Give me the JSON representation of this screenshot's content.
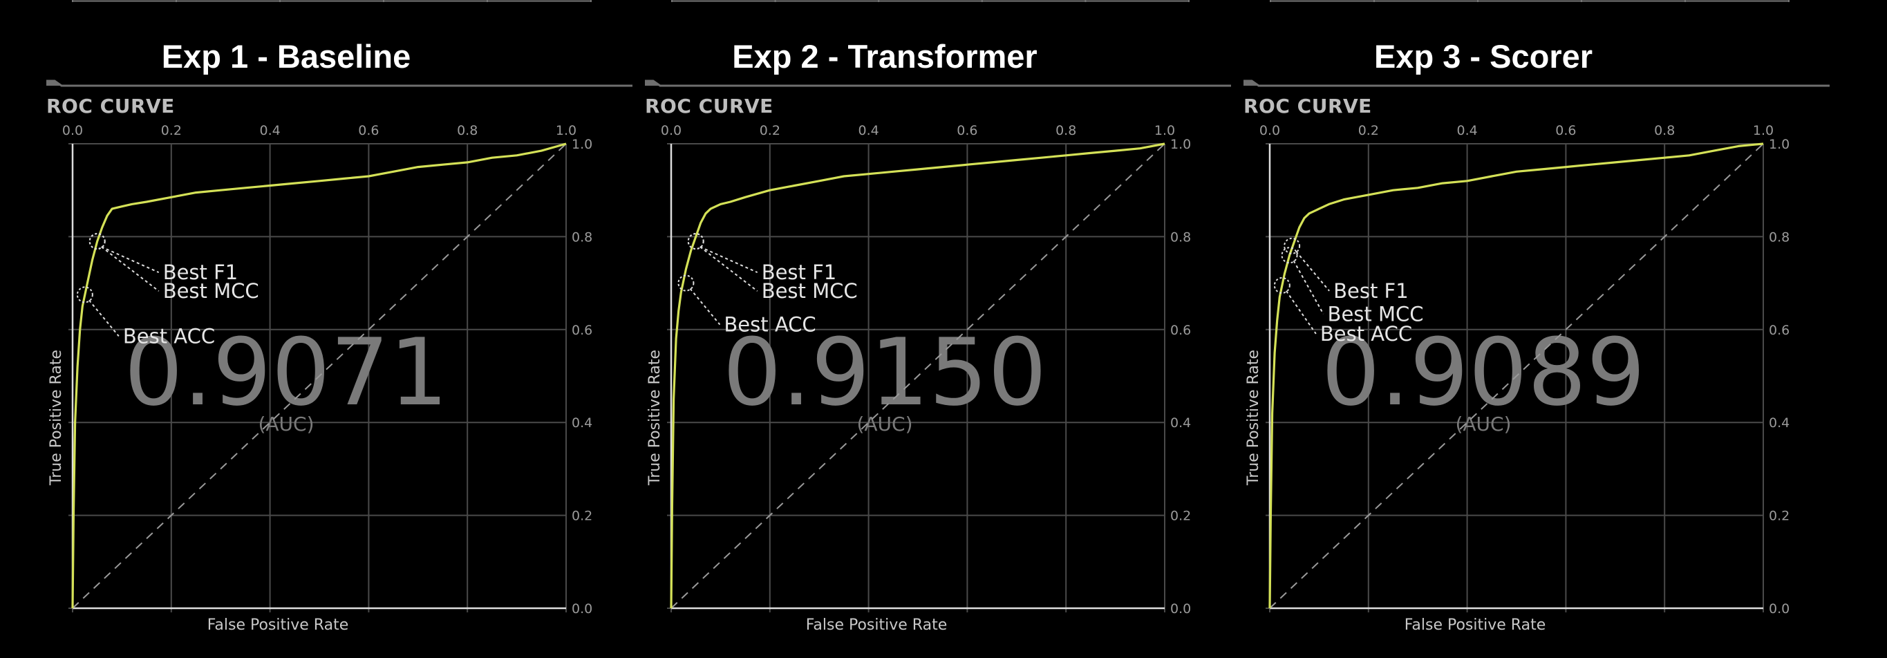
{
  "colors": {
    "background": "#000000",
    "curve": "#d4e157",
    "grid": "#4a4a4a",
    "axis": "#dddddd",
    "text": "#ffffff",
    "muted": "#7a7a7a"
  },
  "chart_data": [
    {
      "type": "line",
      "title": "Exp 1 - Baseline",
      "section_label": "ROC CURVE",
      "xlabel": "False Positive Rate",
      "ylabel": "True Positive Rate",
      "xlim": [
        0,
        1
      ],
      "ylim": [
        0,
        1
      ],
      "x_ticks": [
        "0.0",
        "0.2",
        "0.4",
        "0.6",
        "0.8",
        "1.0"
      ],
      "y_ticks": [
        "0.0",
        "0.2",
        "0.4",
        "0.6",
        "0.8",
        "1.0"
      ],
      "grid": true,
      "auc_value": "0.9071",
      "auc_label": "(AUC)",
      "series": [
        {
          "x": [
            0,
            0.002,
            0.005,
            0.01,
            0.015,
            0.02,
            0.03,
            0.04,
            0.05,
            0.06,
            0.07,
            0.08,
            0.1,
            0.12,
            0.15,
            0.2,
            0.25,
            0.3,
            0.35,
            0.4,
            0.45,
            0.5,
            0.55,
            0.6,
            0.65,
            0.7,
            0.75,
            0.8,
            0.85,
            0.9,
            0.95,
            1.0
          ],
          "y": [
            0,
            0.2,
            0.4,
            0.52,
            0.6,
            0.65,
            0.7,
            0.75,
            0.79,
            0.82,
            0.845,
            0.86,
            0.865,
            0.87,
            0.875,
            0.885,
            0.895,
            0.9,
            0.905,
            0.91,
            0.915,
            0.92,
            0.925,
            0.93,
            0.94,
            0.95,
            0.955,
            0.96,
            0.97,
            0.975,
            0.985,
            1.0
          ]
        },
        {
          "x": [
            0,
            1
          ],
          "y": [
            0,
            1
          ]
        }
      ],
      "annotations": [
        {
          "text": "Best F1",
          "x": 0.05,
          "y": 0.79
        },
        {
          "text": "Best MCC",
          "x": 0.05,
          "y": 0.79
        },
        {
          "text": "Best ACC",
          "x": 0.025,
          "y": 0.675
        }
      ]
    },
    {
      "type": "line",
      "title": "Exp 2 - Transformer",
      "section_label": "ROC CURVE",
      "xlabel": "False Positive Rate",
      "ylabel": "True Positive Rate",
      "xlim": [
        0,
        1
      ],
      "ylim": [
        0,
        1
      ],
      "x_ticks": [
        "0.0",
        "0.2",
        "0.4",
        "0.6",
        "0.8",
        "1.0"
      ],
      "y_ticks": [
        "0.0",
        "0.2",
        "0.4",
        "0.6",
        "0.8",
        "1.0"
      ],
      "grid": true,
      "auc_value": "0.9150",
      "auc_label": "(AUC)",
      "series": [
        {
          "x": [
            0,
            0.002,
            0.005,
            0.01,
            0.015,
            0.02,
            0.03,
            0.04,
            0.05,
            0.06,
            0.07,
            0.08,
            0.1,
            0.12,
            0.15,
            0.2,
            0.25,
            0.3,
            0.35,
            0.4,
            0.45,
            0.5,
            0.55,
            0.6,
            0.65,
            0.7,
            0.75,
            0.8,
            0.85,
            0.9,
            0.95,
            1.0
          ],
          "y": [
            0,
            0.22,
            0.45,
            0.58,
            0.64,
            0.68,
            0.73,
            0.77,
            0.8,
            0.83,
            0.85,
            0.86,
            0.87,
            0.875,
            0.885,
            0.9,
            0.91,
            0.92,
            0.93,
            0.935,
            0.94,
            0.945,
            0.95,
            0.955,
            0.96,
            0.965,
            0.97,
            0.975,
            0.98,
            0.985,
            0.99,
            1.0
          ]
        },
        {
          "x": [
            0,
            1
          ],
          "y": [
            0,
            1
          ]
        }
      ],
      "annotations": [
        {
          "text": "Best F1",
          "x": 0.05,
          "y": 0.79
        },
        {
          "text": "Best MCC",
          "x": 0.05,
          "y": 0.79
        },
        {
          "text": "Best ACC",
          "x": 0.03,
          "y": 0.7
        }
      ]
    },
    {
      "type": "line",
      "title": "Exp 3 - Scorer",
      "section_label": "ROC CURVE",
      "xlabel": "False Positive Rate",
      "ylabel": "True Positive Rate",
      "xlim": [
        0,
        1
      ],
      "ylim": [
        0,
        1
      ],
      "x_ticks": [
        "0.0",
        "0.2",
        "0.4",
        "0.6",
        "0.8",
        "1.0"
      ],
      "y_ticks": [
        "0.0",
        "0.2",
        "0.4",
        "0.6",
        "0.8",
        "1.0"
      ],
      "grid": true,
      "auc_value": "0.9089",
      "auc_label": "(AUC)",
      "series": [
        {
          "x": [
            0,
            0.002,
            0.005,
            0.01,
            0.015,
            0.02,
            0.03,
            0.04,
            0.05,
            0.06,
            0.07,
            0.08,
            0.1,
            0.12,
            0.15,
            0.2,
            0.25,
            0.3,
            0.35,
            0.4,
            0.45,
            0.5,
            0.55,
            0.6,
            0.65,
            0.7,
            0.75,
            0.8,
            0.85,
            0.9,
            0.95,
            1.0
          ],
          "y": [
            0,
            0.2,
            0.42,
            0.55,
            0.62,
            0.67,
            0.72,
            0.76,
            0.79,
            0.82,
            0.84,
            0.85,
            0.86,
            0.87,
            0.88,
            0.89,
            0.9,
            0.905,
            0.915,
            0.92,
            0.93,
            0.94,
            0.945,
            0.95,
            0.955,
            0.96,
            0.965,
            0.97,
            0.975,
            0.985,
            0.995,
            1.0
          ]
        },
        {
          "x": [
            0,
            1
          ],
          "y": [
            0,
            1
          ]
        }
      ],
      "annotations": [
        {
          "text": "Best F1",
          "x": 0.045,
          "y": 0.78
        },
        {
          "text": "Best MCC",
          "x": 0.04,
          "y": 0.76
        },
        {
          "text": "Best ACC",
          "x": 0.025,
          "y": 0.695
        }
      ]
    }
  ]
}
